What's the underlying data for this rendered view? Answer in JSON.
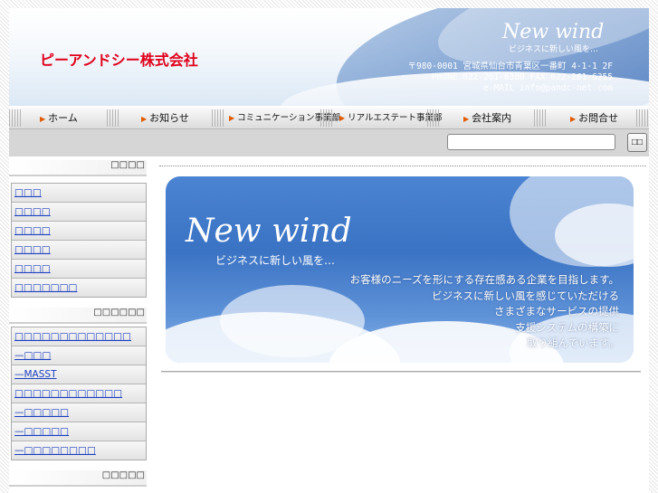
{
  "header": {
    "company": "ピーアンドシー株式会社",
    "tagline_en": "New wind",
    "tagline_jp": "ビジネスに新しい風を…",
    "address": "〒980-0001 宮城県仙台市青葉区一番町 4-1-1 2F",
    "phone": "PHONE 022-261-6380 FAX 022-261-6355",
    "email": "e-MAIL info@pandc-net.com"
  },
  "nav": {
    "items": [
      {
        "label": "ホーム"
      },
      {
        "label": "お知らせ"
      },
      {
        "label": "コミュニケーション事業部"
      },
      {
        "label": "リアルエステート事業部"
      },
      {
        "label": "会社案内"
      },
      {
        "label": "お問合せ"
      }
    ],
    "arrow": "▶"
  },
  "search": {
    "value": "",
    "button_label": "□□"
  },
  "sidebar": {
    "section1": {
      "title": "□□□□",
      "items": [
        "□□□",
        "□□□□",
        "□□□□",
        "□□□□",
        "□□□□",
        "□□□□□□□"
      ]
    },
    "section2": {
      "title": "□□□□□□",
      "items": [
        "□□□□□□□□□□□□□",
        "—□□□",
        "—MASST",
        "□□□□□□□□□□□□",
        "—□□□□□",
        "—□□□□□",
        "—□□□□□□□□"
      ]
    },
    "section3": {
      "title": "□□□□□"
    }
  },
  "banner": {
    "title_en": "New wind",
    "subtitle": "ビジネスに新しい風を…",
    "lines": [
      "お客様のニーズを形にする存在感ある企業を目指します。",
      "ビジネスに新しい風を感じていただける",
      "さまざまなサービスの提供",
      "支援システムの構築に",
      "取り組んでいます。"
    ]
  },
  "colors": {
    "logo_red": "#e0001a",
    "link_blue": "#1a3fc0",
    "banner_blue": "#3b73c4"
  }
}
